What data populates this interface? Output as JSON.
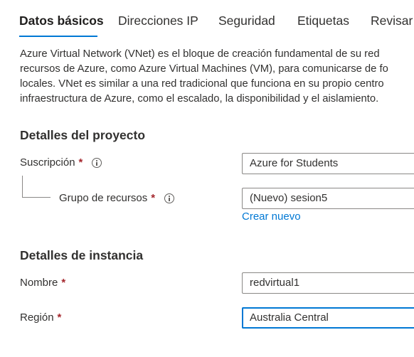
{
  "tabs": [
    {
      "label": "Datos básicos",
      "active": true
    },
    {
      "label": "Direcciones IP",
      "active": false
    },
    {
      "label": "Seguridad",
      "active": false
    },
    {
      "label": "Etiquetas",
      "active": false
    },
    {
      "label": "Revisar y",
      "active": false
    }
  ],
  "intro": [
    "Azure Virtual Network (VNet) es el bloque de creación fundamental de su red",
    "recursos de Azure, como Azure Virtual Machines (VM), para comunicarse de fo",
    "locales. VNet es similar a una red tradicional que funciona en su propio centro",
    "infraestructura de Azure, como el escalado, la disponibilidad y el aislamiento."
  ],
  "project_details": {
    "title": "Detalles del proyecto",
    "subscription_label": "Suscripción",
    "subscription_value": "Azure for Students",
    "resource_group_label": "Grupo de recursos",
    "resource_group_value": "(Nuevo) sesion5",
    "create_new_link": "Crear nuevo"
  },
  "instance_details": {
    "title": "Detalles de instancia",
    "name_label": "Nombre",
    "name_value": "redvirtual1",
    "region_label": "Región",
    "region_value": "Australia Central"
  },
  "required_marker": "*",
  "colors": {
    "accent": "#0078d4",
    "required": "#a4262c",
    "text": "#323130",
    "border": "#8a8886"
  }
}
